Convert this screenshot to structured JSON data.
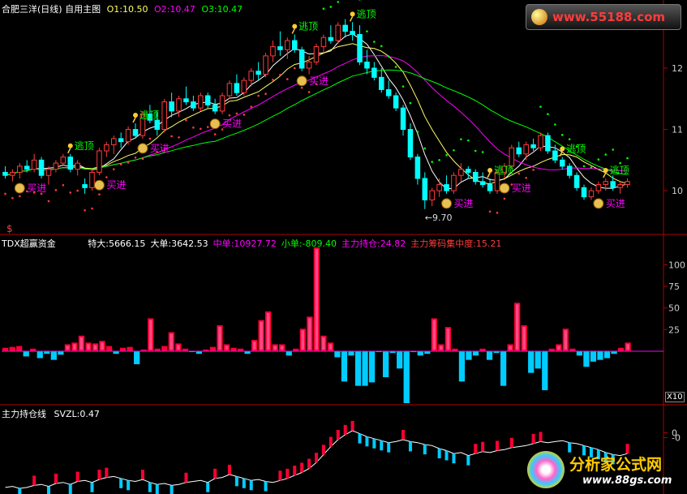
{
  "colors": {
    "up": "#ff3b3b",
    "down": "#00ffff",
    "ma1": "#ffffff",
    "ma2": "#ff00ff",
    "ma3": "#ffff66",
    "ma4": "#00ff00",
    "buy": "#ff00ff",
    "escape": "#00ff00",
    "frame": "#b00000",
    "bullish": "#ff0033",
    "bearish": "#00ccff"
  },
  "header": {
    "title": "合肥三洋(日线) 自用主图",
    "o1": "O1:10.50",
    "o2": "O2:10.47",
    "o3": "O3:10.47",
    "dollar": "$"
  },
  "watermark_top": "www.55188.com",
  "watermark_bottom": {
    "name": "分析家公式网",
    "url": "www.88gs.com"
  },
  "fund_panel": {
    "title": "TDX超赢资金",
    "stats": [
      {
        "label": "特大:",
        "value": "5666.15",
        "color": "#ffffff"
      },
      {
        "label": "大单:",
        "value": "3642.53",
        "color": "#ffffff"
      },
      {
        "label": "中单:",
        "value": "10927.72",
        "color": "#ff00ff"
      },
      {
        "label": "小单:",
        "value": "-809.40",
        "color": "#00ff00"
      },
      {
        "label": "主力持仓:",
        "value": "24.82",
        "color": "#ff00ff"
      },
      {
        "label": "主力筹码集中度:",
        "value": "15.21",
        "color": "#ff3b3b"
      }
    ],
    "multiplier": "X10"
  },
  "hold_panel": {
    "title": "主力持仓线",
    "stat": "SVZL:0.47"
  },
  "chart_data": [
    {
      "type": "candlestick",
      "name": "price",
      "ylim": [
        9.3,
        12.9
      ],
      "yticks": [
        12,
        11,
        10
      ],
      "ohlc": [
        [
          10.3,
          10.4,
          10.2,
          10.25
        ],
        [
          10.25,
          10.35,
          10.15,
          10.3
        ],
        [
          10.3,
          10.45,
          10.2,
          10.4
        ],
        [
          10.4,
          10.5,
          10.3,
          10.35
        ],
        [
          10.35,
          10.6,
          10.3,
          10.5
        ],
        [
          10.5,
          10.55,
          10.2,
          10.25
        ],
        [
          10.25,
          10.4,
          10.1,
          10.35
        ],
        [
          10.35,
          10.5,
          10.3,
          10.45
        ],
        [
          10.45,
          10.6,
          10.4,
          10.55
        ],
        [
          10.55,
          10.6,
          10.3,
          10.35
        ],
        [
          10.35,
          10.5,
          10.25,
          10.45
        ],
        [
          10.1,
          10.2,
          9.95,
          10.05
        ],
        [
          10.05,
          10.35,
          10.0,
          10.3
        ],
        [
          10.3,
          10.7,
          10.25,
          10.65
        ],
        [
          10.65,
          10.8,
          10.55,
          10.75
        ],
        [
          10.75,
          10.9,
          10.6,
          10.85
        ],
        [
          10.85,
          10.95,
          10.7,
          10.8
        ],
        [
          10.8,
          11.05,
          10.75,
          11.0
        ],
        [
          11.0,
          11.1,
          10.85,
          10.9
        ],
        [
          10.9,
          11.3,
          10.85,
          11.25
        ],
        [
          11.25,
          11.4,
          11.1,
          11.15
        ],
        [
          11.15,
          11.3,
          10.9,
          11.0
        ],
        [
          11.0,
          11.5,
          10.95,
          11.45
        ],
        [
          11.45,
          11.6,
          11.2,
          11.3
        ],
        [
          11.3,
          11.55,
          11.2,
          11.5
        ],
        [
          11.5,
          11.7,
          11.4,
          11.45
        ],
        [
          11.45,
          11.55,
          11.3,
          11.35
        ],
        [
          11.35,
          11.6,
          11.3,
          11.55
        ],
        [
          11.55,
          11.6,
          11.35,
          11.4
        ],
        [
          11.4,
          11.5,
          11.25,
          11.3
        ],
        [
          11.3,
          11.6,
          11.25,
          11.55
        ],
        [
          11.55,
          11.8,
          11.5,
          11.75
        ],
        [
          11.75,
          11.9,
          11.55,
          11.6
        ],
        [
          11.6,
          11.85,
          11.55,
          11.8
        ],
        [
          11.8,
          12.0,
          11.7,
          11.95
        ],
        [
          11.95,
          12.1,
          11.8,
          11.9
        ],
        [
          11.9,
          12.25,
          11.85,
          12.2
        ],
        [
          12.2,
          12.45,
          12.1,
          12.35
        ],
        [
          12.35,
          12.6,
          12.2,
          12.3
        ],
        [
          12.3,
          12.5,
          12.15,
          12.45
        ],
        [
          12.45,
          12.55,
          12.25,
          12.3
        ],
        [
          12.3,
          12.35,
          11.95,
          12.0
        ],
        [
          12.0,
          12.2,
          11.9,
          12.1
        ],
        [
          12.1,
          12.4,
          12.05,
          12.35
        ],
        [
          12.35,
          12.55,
          12.25,
          12.5
        ],
        [
          12.5,
          12.7,
          12.4,
          12.45
        ],
        [
          12.45,
          12.75,
          12.4,
          12.7
        ],
        [
          12.7,
          12.8,
          12.5,
          12.6
        ],
        [
          12.6,
          12.75,
          12.45,
          12.55
        ],
        [
          12.55,
          12.7,
          12.05,
          12.1
        ],
        [
          12.1,
          12.3,
          11.9,
          12.0
        ],
        [
          12.0,
          12.1,
          11.8,
          11.85
        ],
        [
          11.85,
          12.0,
          11.6,
          11.65
        ],
        [
          11.65,
          11.8,
          11.5,
          11.55
        ],
        [
          11.55,
          11.6,
          11.3,
          11.35
        ],
        [
          11.35,
          11.4,
          10.9,
          11.0
        ],
        [
          11.0,
          11.1,
          10.5,
          10.55
        ],
        [
          10.55,
          10.6,
          10.1,
          10.2
        ],
        [
          10.2,
          10.3,
          9.7,
          9.85
        ],
        [
          9.85,
          10.05,
          9.75,
          10.0
        ],
        [
          10.0,
          10.2,
          9.9,
          10.1
        ],
        [
          10.1,
          10.25,
          9.95,
          10.0
        ],
        [
          10.0,
          10.3,
          9.95,
          10.25
        ],
        [
          10.25,
          10.45,
          10.15,
          10.35
        ],
        [
          10.35,
          10.4,
          10.2,
          10.3
        ],
        [
          10.3,
          10.35,
          10.1,
          10.15
        ],
        [
          10.15,
          10.3,
          10.05,
          10.1
        ],
        [
          10.1,
          10.2,
          9.95,
          10.0
        ],
        [
          10.0,
          10.35,
          9.95,
          10.3
        ],
        [
          10.3,
          10.45,
          10.2,
          10.4
        ],
        [
          10.4,
          10.75,
          10.35,
          10.7
        ],
        [
          10.7,
          10.8,
          10.55,
          10.6
        ],
        [
          10.6,
          10.8,
          10.5,
          10.75
        ],
        [
          10.75,
          10.85,
          10.65,
          10.7
        ],
        [
          10.7,
          10.95,
          10.65,
          10.9
        ],
        [
          10.9,
          10.95,
          10.6,
          10.65
        ],
        [
          10.65,
          10.75,
          10.45,
          10.5
        ],
        [
          10.5,
          10.55,
          10.35,
          10.4
        ],
        [
          10.4,
          10.45,
          10.2,
          10.25
        ],
        [
          10.25,
          10.3,
          10.0,
          10.05
        ],
        [
          10.05,
          10.1,
          9.85,
          9.9
        ],
        [
          9.9,
          10.05,
          9.85,
          10.0
        ],
        [
          10.0,
          10.15,
          9.95,
          10.1
        ],
        [
          10.1,
          10.2,
          10.0,
          10.15
        ],
        [
          10.15,
          10.25,
          10.0,
          10.05
        ],
        [
          10.05,
          10.15,
          9.95,
          10.1
        ],
        [
          10.1,
          10.2,
          10.05,
          10.15
        ]
      ],
      "ma_periods": [
        5,
        10,
        20,
        30
      ],
      "sar_dots": "red below / green above",
      "annotations": [
        {
          "text": "买进",
          "index": 2,
          "kind": "buy"
        },
        {
          "text": "逃顶",
          "index": 9,
          "kind": "escape"
        },
        {
          "text": "买进",
          "index": 13,
          "kind": "buy"
        },
        {
          "text": "逃顶",
          "index": 18,
          "kind": "escape"
        },
        {
          "text": "买进",
          "index": 19,
          "kind": "buy"
        },
        {
          "text": "买进",
          "index": 29,
          "kind": "buy"
        },
        {
          "text": "逃顶",
          "index": 40,
          "kind": "escape"
        },
        {
          "text": "买进",
          "index": 41,
          "kind": "buy"
        },
        {
          "text": "逃顶",
          "index": 48,
          "kind": "escape"
        },
        {
          "text": "买进",
          "index": 61,
          "kind": "buy"
        },
        {
          "text": "逃顶",
          "index": 67,
          "kind": "escape"
        },
        {
          "text": "买进",
          "index": 69,
          "kind": "buy"
        },
        {
          "text": "逃顶",
          "index": 77,
          "kind": "escape"
        },
        {
          "text": "逃顶",
          "index": 83,
          "kind": "escape"
        },
        {
          "text": "买进",
          "index": 82,
          "kind": "buy"
        }
      ],
      "low_label": {
        "text": "9.70",
        "index": 58
      }
    },
    {
      "type": "bar",
      "name": "fund_flow",
      "ylim": [
        -60,
        120
      ],
      "yticks": [
        100,
        75,
        50,
        25
      ],
      "values": [
        4,
        5,
        6,
        -6,
        3,
        -8,
        -3,
        -10,
        -4,
        8,
        10,
        18,
        10,
        9,
        12,
        6,
        -3,
        4,
        5,
        -15,
        2,
        38,
        3,
        6,
        22,
        9,
        3,
        -1,
        -3,
        2,
        5,
        30,
        8,
        4,
        3,
        -3,
        13,
        36,
        46,
        8,
        8,
        -5,
        3,
        26,
        40,
        120,
        18,
        10,
        -7,
        -35,
        -5,
        -40,
        -40,
        -36,
        -1,
        -30,
        -2,
        -20,
        -60,
        -1,
        -5,
        -3,
        38,
        8,
        28,
        3,
        -35,
        -10,
        -5,
        3,
        -10,
        -2,
        -40,
        8,
        56,
        30,
        -25,
        -20,
        -45,
        3,
        8,
        26,
        3,
        -5,
        -18,
        -12,
        -10,
        -8,
        -3,
        4,
        10
      ]
    },
    {
      "type": "line",
      "name": "hold_line",
      "ylim": [
        -0.6,
        0.15
      ],
      "yticks": [
        "0",
        "-0"
      ],
      "values": [
        -0.55,
        -0.54,
        -0.56,
        -0.55,
        -0.53,
        -0.52,
        -0.54,
        -0.51,
        -0.5,
        -0.52,
        -0.49,
        -0.48,
        -0.5,
        -0.47,
        -0.45,
        -0.44,
        -0.46,
        -0.48,
        -0.49,
        -0.47,
        -0.5,
        -0.52,
        -0.51,
        -0.53,
        -0.52,
        -0.5,
        -0.49,
        -0.48,
        -0.5,
        -0.46,
        -0.45,
        -0.42,
        -0.44,
        -0.46,
        -0.48,
        -0.47,
        -0.49,
        -0.5,
        -0.48,
        -0.46,
        -0.43,
        -0.4,
        -0.36,
        -0.3,
        -0.22,
        -0.14,
        -0.07,
        -0.02,
        0.02,
        -0.01,
        -0.04,
        -0.06,
        -0.08,
        -0.1,
        -0.09,
        -0.07,
        -0.09,
        -0.1,
        -0.12,
        -0.13,
        -0.16,
        -0.18,
        -0.21,
        -0.2,
        -0.23,
        -0.21,
        -0.19,
        -0.2,
        -0.18,
        -0.17,
        -0.15,
        -0.14,
        -0.13,
        -0.11,
        -0.09,
        -0.1,
        -0.09,
        -0.08,
        -0.1,
        -0.11,
        -0.13,
        -0.15,
        -0.17,
        -0.2,
        -0.22,
        -0.23,
        -0.21
      ]
    }
  ]
}
